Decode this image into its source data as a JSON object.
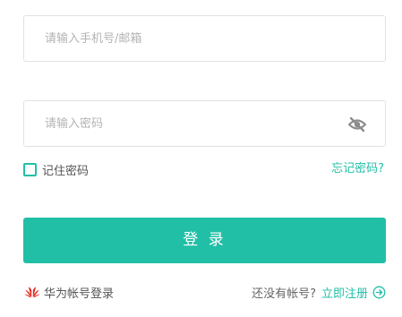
{
  "form": {
    "account": {
      "value": "",
      "placeholder": "请输入手机号/邮箱"
    },
    "password": {
      "value": "",
      "placeholder": "请输入密码",
      "visibility_icon": "eye-off-icon"
    },
    "remember_label": "记住密码",
    "remember_checked": false,
    "forgot_label": "忘记密码?",
    "login_label": "登 录"
  },
  "footer": {
    "huawei_icon": "huawei-logo-icon",
    "huawei_label": "华为帐号登录",
    "no_account_text": "还没有帐号?",
    "register_label": "立即注册",
    "register_icon": "circle-arrow-right-icon"
  },
  "colors": {
    "accent": "#22bfa7",
    "huawei_red": "#e1251b",
    "input_border": "#e2e2e2",
    "placeholder": "#b3b3b3"
  }
}
